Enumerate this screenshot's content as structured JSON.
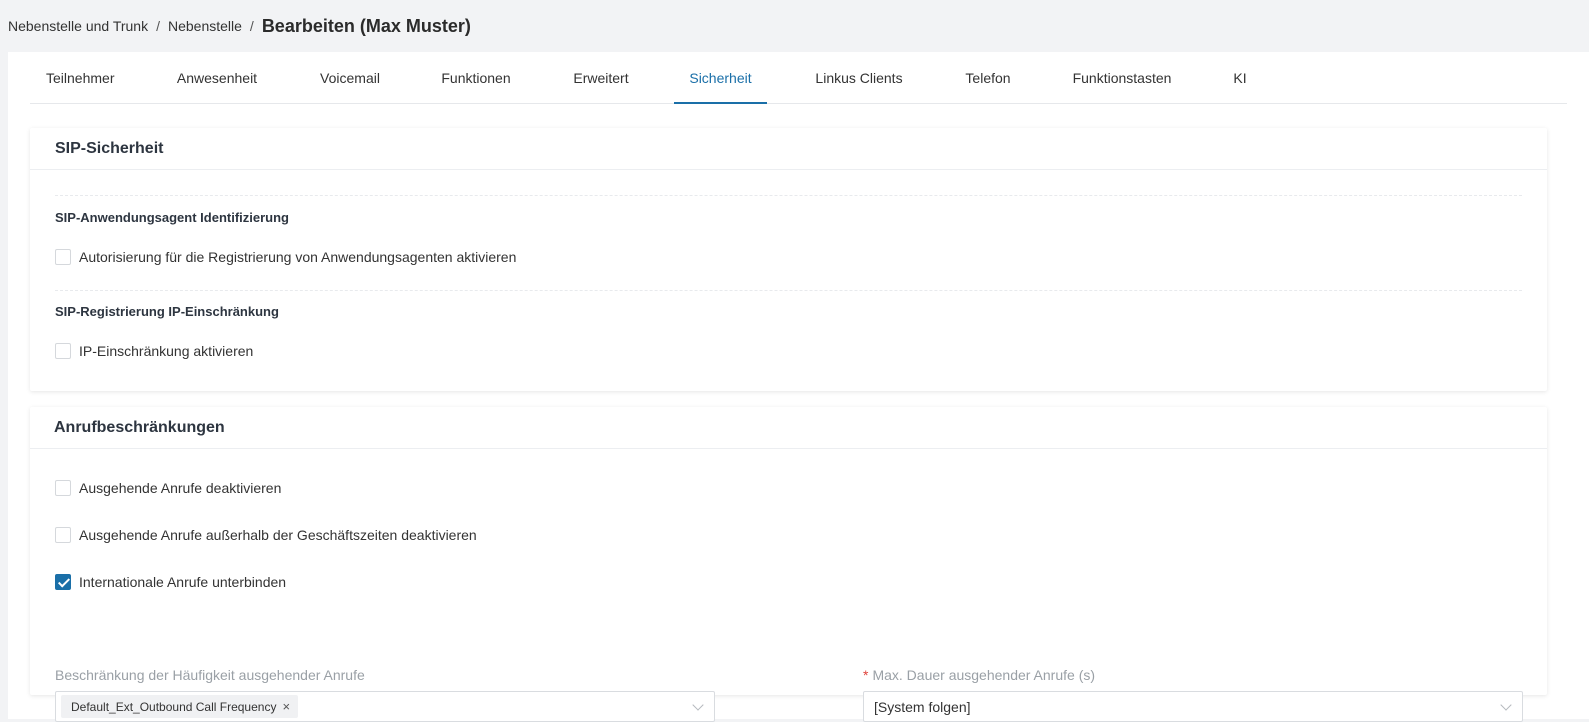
{
  "breadcrumb": {
    "items": [
      "Nebenstelle und Trunk",
      "Nebenstelle"
    ],
    "separator": "/",
    "current": "Bearbeiten (Max Muster)"
  },
  "tabs": [
    {
      "label": "Teilnehmer"
    },
    {
      "label": "Anwesenheit"
    },
    {
      "label": "Voicemail"
    },
    {
      "label": "Funktionen"
    },
    {
      "label": "Erweitert"
    },
    {
      "label": "Sicherheit",
      "active": true
    },
    {
      "label": "Linkus Clients"
    },
    {
      "label": "Telefon"
    },
    {
      "label": "Funktionstasten"
    },
    {
      "label": "KI"
    }
  ],
  "sip_security": {
    "title": "SIP-Sicherheit",
    "ua_section": {
      "title": "SIP-Anwendungsagent Identifizierung",
      "checkbox_label": "Autorisierung für die Registrierung von Anwendungsagenten aktivieren",
      "checked": false
    },
    "ip_section": {
      "title": "SIP-Registrierung IP-Einschränkung",
      "checkbox_label": "IP-Einschränkung aktivieren",
      "checked": false
    }
  },
  "call_restrictions": {
    "title": "Anrufbeschränkungen",
    "options": [
      {
        "label": "Ausgehende Anrufe deaktivieren",
        "checked": false
      },
      {
        "label": "Ausgehende Anrufe außerhalb der Geschäftszeiten deaktivieren",
        "checked": false
      },
      {
        "label": "Internationale Anrufe unterbinden",
        "checked": true
      }
    ],
    "frequency": {
      "label": "Beschränkung der Häufigkeit ausgehender Anrufe",
      "tag": "Default_Ext_Outbound Call Frequency",
      "remove_glyph": "×"
    },
    "max_duration": {
      "required_mark": "*",
      "label": "Max. Dauer ausgehender Anrufe (s)",
      "value": "[System folgen]"
    }
  },
  "colors": {
    "accent": "#1a6fa8",
    "required": "#e0433b",
    "page_bg": "#f2f3f5"
  }
}
